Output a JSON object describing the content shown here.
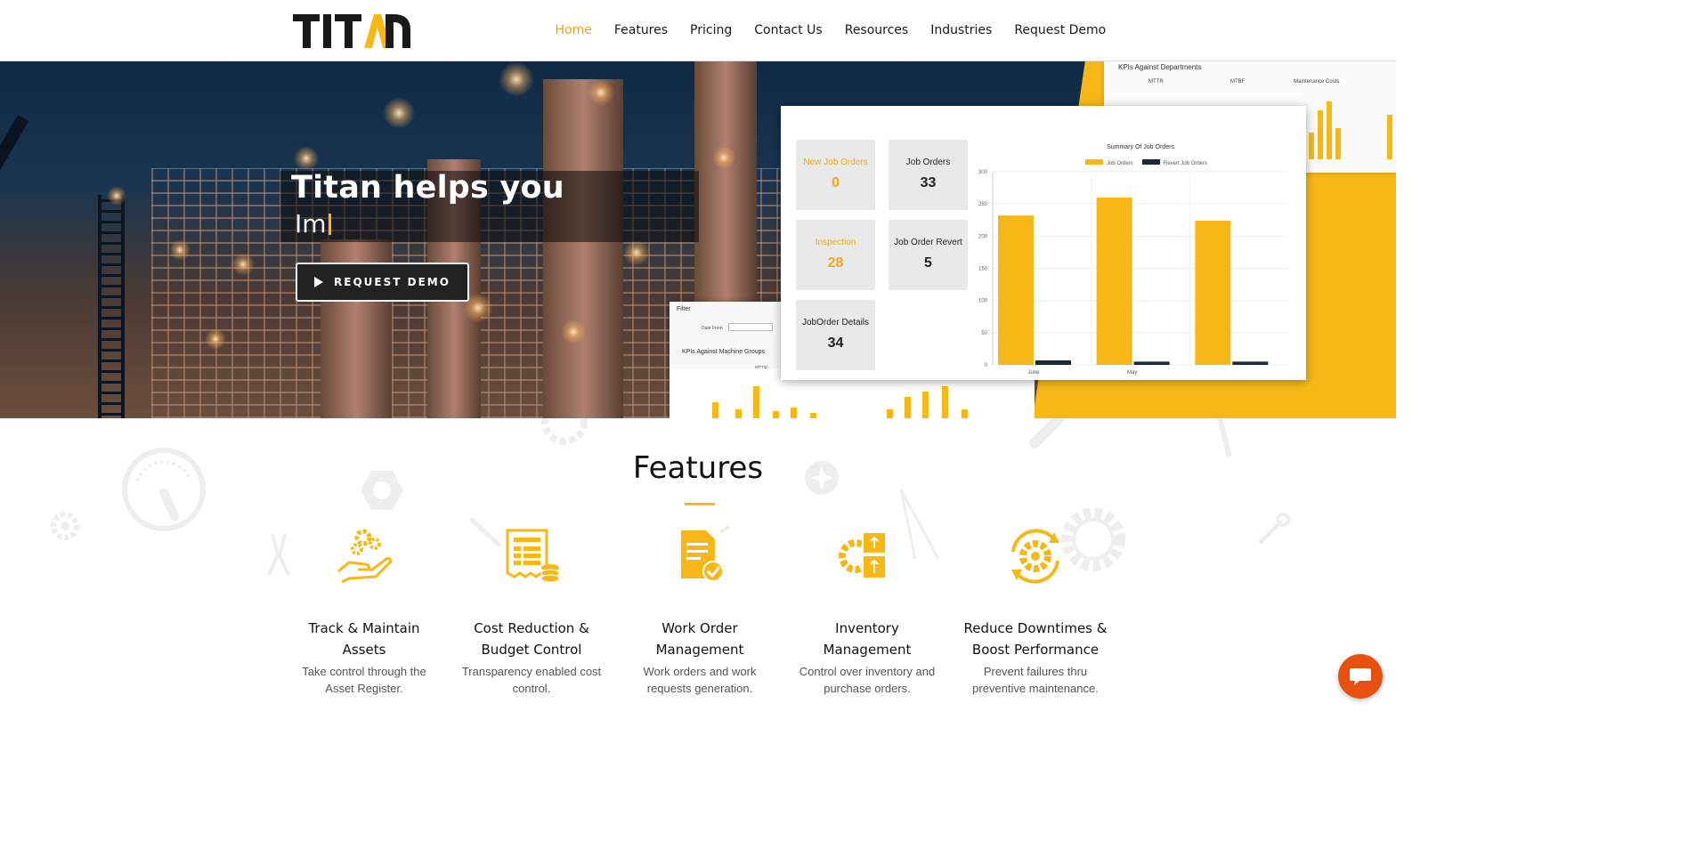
{
  "brand": {
    "logo_text": "TITAN",
    "accent": "#f7b817",
    "nav_active": "#e8a317",
    "chat_color": "#e8500f"
  },
  "nav": {
    "items": [
      {
        "label": "Home",
        "active": true
      },
      {
        "label": "Features",
        "active": false
      },
      {
        "label": "Pricing",
        "active": false
      },
      {
        "label": "Contact Us",
        "active": false
      },
      {
        "label": "Resources",
        "active": false
      },
      {
        "label": "Industries",
        "active": false
      },
      {
        "label": "Request Demo",
        "active": false
      }
    ]
  },
  "hero": {
    "title": "Titan helps you",
    "typed_text": "Im",
    "cta_label": "REQUEST DEMO",
    "cta_icon": "play-icon"
  },
  "dashboard": {
    "back_panel_title": "KPIs Against Departments",
    "back_panel_labels": [
      "MTTR",
      "MTBF",
      "Maintenance Costs"
    ],
    "filter_title": "Filter",
    "filter_date_label": "Date From",
    "machine_groups_title": "KPIs Against Machine Groups",
    "machine_groups_sub": "MTTR",
    "cards": [
      {
        "label": "New Job Orders",
        "value": "0",
        "highlight": true
      },
      {
        "label": "Job Orders",
        "value": "33",
        "highlight": false
      },
      {
        "label": "Inspection",
        "value": "28",
        "highlight": true
      },
      {
        "label": "Job Order Revert",
        "value": "5",
        "highlight": false
      },
      {
        "label": "JobOrder Details",
        "value": "34",
        "highlight": false
      }
    ]
  },
  "chart_data": {
    "type": "bar",
    "title": "Summary Of Job Orders",
    "categories": [
      "June",
      "May",
      ""
    ],
    "series": [
      {
        "name": "Job Orders",
        "color": "#f7b817",
        "values": [
          232,
          260,
          224
        ]
      },
      {
        "name": "Revert Job Orders",
        "color": "#1e2833",
        "values": [
          7,
          5,
          5
        ]
      }
    ],
    "yticks": [
      0,
      50,
      100,
      150,
      200,
      250,
      300
    ],
    "ylim": [
      0,
      300
    ],
    "legend": "top",
    "grid": true
  },
  "features": {
    "title": "Features",
    "items": [
      {
        "heading_line1": "Track & Maintain",
        "heading_line2": "Assets",
        "desc_line1": "Take control through the",
        "desc_line2": "Asset Register.",
        "icon": "hand-gears-icon"
      },
      {
        "heading_line1": "Cost Reduction &",
        "heading_line2": "Budget Control",
        "desc_line1": "Transparency enabled cost",
        "desc_line2": "control.",
        "icon": "receipt-coins-icon"
      },
      {
        "heading_line1": "Work Order",
        "heading_line2": "Management",
        "desc_line1": "Work orders and work",
        "desc_line2": "requests generation.",
        "icon": "document-check-icon"
      },
      {
        "heading_line1": "Inventory",
        "heading_line2": "Management",
        "desc_line1": "Control over inventory and",
        "desc_line2": "purchase orders.",
        "icon": "inventory-gear-icon"
      },
      {
        "heading_line1": "Reduce Downtimes &",
        "heading_line2": "Boost Performance",
        "desc_line1": "Prevent failures thru",
        "desc_line2": "preventive maintenance.",
        "icon": "gear-cycle-icon"
      }
    ]
  },
  "chat": {
    "icon": "chat-icon"
  }
}
